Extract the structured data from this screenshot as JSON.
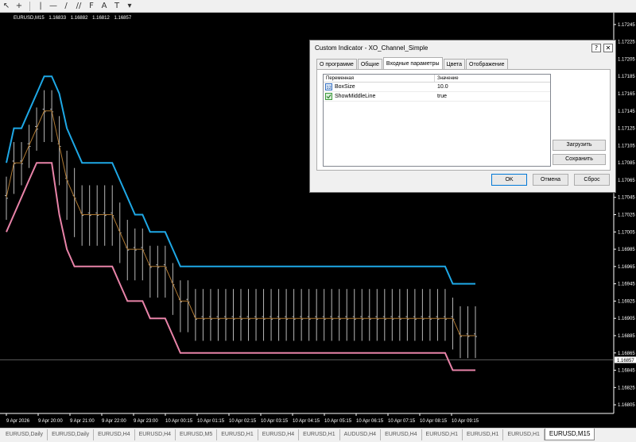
{
  "toolbar": {
    "icons": [
      "cursor-icon",
      "crosshair-icon",
      "vertical-line-icon",
      "horizontal-line-icon",
      "trendline-icon",
      "channel-icon",
      "fibonacci-icon",
      "text-icon",
      "label-icon",
      "shapes-icon"
    ],
    "glyphs": [
      "↖",
      "+",
      "|",
      "—",
      "/",
      "//",
      "F",
      "A",
      "T",
      "▾"
    ]
  },
  "chart": {
    "symbol_info": "EURUSD,M15",
    "ohlc": [
      "1.16833",
      "1.16882",
      "1.16812",
      "1.16857"
    ],
    "current_price": "1.16857",
    "price_ticks": [
      "1.17245",
      "1.17225",
      "1.17205",
      "1.17185",
      "1.17165",
      "1.17145",
      "1.17125",
      "1.17105",
      "1.17085",
      "1.17065",
      "1.17045",
      "1.17025",
      "1.17005",
      "1.16985",
      "1.16965",
      "1.16945",
      "1.16925",
      "1.16905",
      "1.16885",
      "1.16865",
      "1.16845",
      "1.16825",
      "1.16805"
    ],
    "time_ticks": [
      "9 Apr 2026",
      "9 Apr 20:00",
      "9 Apr 21:00",
      "9 Apr 22:00",
      "9 Apr 23:00",
      "10 Apr 00:15",
      "10 Apr 01:15",
      "10 Apr 02:15",
      "10 Apr 03:15",
      "10 Apr 04:15",
      "10 Apr 05:15",
      "10 Apr 06:15",
      "10 Apr 07:15",
      "10 Apr 08:15",
      "10 Apr 09:15"
    ],
    "colors": {
      "upper": "#1ea8e6",
      "middle": "#b07a33",
      "lower": "#e883a8",
      "bars": "#b8b8b8"
    }
  },
  "chart_data": {
    "type": "line",
    "xlabel": "",
    "ylabel": "",
    "ylim": [
      1.16795,
      1.17255
    ],
    "series": [
      {
        "name": "upper",
        "x": [
          0,
          4,
          8,
          12,
          16,
          20,
          24,
          28,
          32,
          36,
          40,
          44,
          48,
          52,
          56,
          60,
          64,
          68,
          72,
          76,
          80,
          84,
          88,
          92,
          96,
          100,
          104,
          108,
          112,
          116,
          120,
          124,
          128,
          132,
          136,
          140,
          144,
          148,
          152,
          156,
          160,
          164,
          168,
          172,
          176,
          180,
          184,
          188,
          192,
          196,
          200,
          204,
          208,
          212,
          216,
          220,
          224,
          228,
          232,
          236,
          240,
          244,
          248
        ],
        "values": [
          1.17085,
          1.17125,
          1.17125,
          1.17145,
          1.17165,
          1.17185,
          1.17185,
          1.17165,
          1.17125,
          1.17105,
          1.17085,
          1.17085,
          1.17085,
          1.17085,
          1.17085,
          1.17065,
          1.17045,
          1.17025,
          1.17025,
          1.17005,
          1.17005,
          1.17005,
          1.16985,
          1.16965,
          1.16965,
          1.16965,
          1.16965,
          1.16965,
          1.16965,
          1.16965,
          1.16965,
          1.16965,
          1.16965,
          1.16965,
          1.16965,
          1.16965,
          1.16965,
          1.16965,
          1.16965,
          1.16965,
          1.16965,
          1.16965,
          1.16965,
          1.16965,
          1.16965,
          1.16965,
          1.16965,
          1.16965,
          1.16965,
          1.16965,
          1.16965,
          1.16965,
          1.16965,
          1.16965,
          1.16965,
          1.16965,
          1.16965,
          1.16965,
          1.16965,
          1.16945,
          1.16945,
          1.16945,
          1.16945
        ]
      },
      {
        "name": "middle",
        "x": [
          0,
          4,
          8,
          12,
          16,
          20,
          24,
          28,
          32,
          36,
          40,
          44,
          48,
          52,
          56,
          60,
          64,
          68,
          72,
          76,
          80,
          84,
          88,
          92,
          96,
          100,
          104,
          108,
          112,
          116,
          120,
          124,
          128,
          132,
          136,
          140,
          144,
          148,
          152,
          156,
          160,
          164,
          168,
          172,
          176,
          180,
          184,
          188,
          192,
          196,
          200,
          204,
          208,
          212,
          216,
          220,
          224,
          228,
          232,
          236,
          240,
          244,
          248
        ],
        "values": [
          1.17045,
          1.17085,
          1.17085,
          1.17105,
          1.17125,
          1.17145,
          1.17145,
          1.17105,
          1.17065,
          1.17045,
          1.17025,
          1.17025,
          1.17025,
          1.17025,
          1.17025,
          1.17005,
          1.16985,
          1.16985,
          1.16985,
          1.16965,
          1.16965,
          1.16965,
          1.16945,
          1.16925,
          1.16925,
          1.16905,
          1.16905,
          1.16905,
          1.16905,
          1.16905,
          1.16905,
          1.16905,
          1.16905,
          1.16905,
          1.16905,
          1.16905,
          1.16905,
          1.16905,
          1.16905,
          1.16905,
          1.16905,
          1.16905,
          1.16905,
          1.16905,
          1.16905,
          1.16905,
          1.16905,
          1.16905,
          1.16905,
          1.16905,
          1.16905,
          1.16905,
          1.16905,
          1.16905,
          1.16905,
          1.16905,
          1.16905,
          1.16905,
          1.16905,
          1.16905,
          1.16885,
          1.16885,
          1.16885
        ]
      },
      {
        "name": "lower",
        "x": [
          0,
          4,
          8,
          12,
          16,
          20,
          24,
          28,
          32,
          36,
          40,
          44,
          48,
          52,
          56,
          60,
          64,
          68,
          72,
          76,
          80,
          84,
          88,
          92,
          96,
          100,
          104,
          108,
          112,
          116,
          120,
          124,
          128,
          132,
          136,
          140,
          144,
          148,
          152,
          156,
          160,
          164,
          168,
          172,
          176,
          180,
          184,
          188,
          192,
          196,
          200,
          204,
          208,
          212,
          216,
          220,
          224,
          228,
          232,
          236,
          240,
          244,
          248
        ],
        "values": [
          1.17005,
          1.17025,
          1.17045,
          1.17065,
          1.17085,
          1.17085,
          1.17085,
          1.17025,
          1.16985,
          1.16965,
          1.16965,
          1.16965,
          1.16965,
          1.16965,
          1.16965,
          1.16945,
          1.16925,
          1.16925,
          1.16925,
          1.16905,
          1.16905,
          1.16905,
          1.16885,
          1.16865,
          1.16865,
          1.16865,
          1.16865,
          1.16865,
          1.16865,
          1.16865,
          1.16865,
          1.16865,
          1.16865,
          1.16865,
          1.16865,
          1.16865,
          1.16865,
          1.16865,
          1.16865,
          1.16865,
          1.16865,
          1.16865,
          1.16865,
          1.16865,
          1.16865,
          1.16865,
          1.16865,
          1.16865,
          1.16865,
          1.16865,
          1.16865,
          1.16865,
          1.16865,
          1.16865,
          1.16865,
          1.16865,
          1.16865,
          1.16865,
          1.16865,
          1.16845,
          1.16845,
          1.16845,
          1.16845
        ]
      }
    ]
  },
  "dialog": {
    "title": "Custom Indicator - XO_Channel_Simple",
    "help_label": "?",
    "close_label": "✕",
    "tabs": [
      "О программе",
      "Общие",
      "Входные параметры",
      "Цвета",
      "Отображение"
    ],
    "active_tab": 2,
    "table": {
      "col_variable": "Переменная",
      "col_value": "Значение",
      "rows": [
        {
          "name": "BoxSize",
          "value": "10.0",
          "icon": "numeric-param-icon",
          "icon_color": "#3b74c4"
        },
        {
          "name": "ShowMiddleLine",
          "value": "true",
          "icon": "boolean-param-icon",
          "icon_color": "#3c9a3c"
        }
      ]
    },
    "load_label": "Загрузить",
    "save_label": "Сохранить",
    "ok_label": "OK",
    "cancel_label": "Отмена",
    "reset_label": "Сброс"
  },
  "tabs": [
    "EURUSD,Daily",
    "EURUSD,Daily",
    "EURUSD,H4",
    "EURUSD,H4",
    "EURUSD,M5",
    "EURUSD,H1",
    "EURUSD,H4",
    "EURUSD,H1",
    "AUDUSD,H4",
    "EURUSD,H4",
    "EURUSD,H1",
    "EURUSD,H1",
    "EURUSD,H1",
    "EURUSD,M15"
  ],
  "active_tab": 13
}
